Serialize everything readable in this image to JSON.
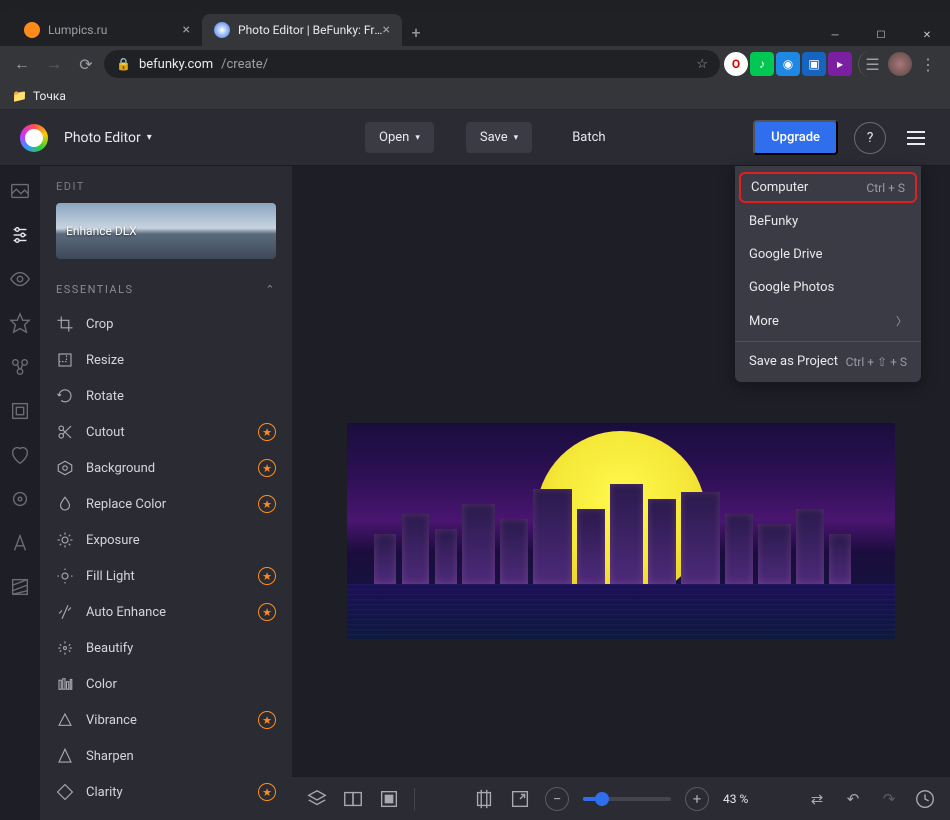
{
  "window": {
    "tabs": [
      {
        "title": "Lumpics.ru",
        "favicon": "#ff8c1a",
        "active": false
      },
      {
        "title": "Photo Editor | BeFunky: Free Onli",
        "favicon": "#2f6fed",
        "active": true
      }
    ]
  },
  "browser": {
    "url_host": "befunky.com",
    "url_path": "/create/",
    "bookmarks": [
      "Точка"
    ]
  },
  "header": {
    "mode": "Photo Editor",
    "open": "Open",
    "save": "Save",
    "batch": "Batch",
    "upgrade": "Upgrade"
  },
  "save_menu": {
    "items": [
      {
        "label": "Computer",
        "shortcut": "Ctrl + S",
        "highlighted": true
      },
      {
        "label": "BeFunky"
      },
      {
        "label": "Google Drive"
      },
      {
        "label": "Google Photos"
      },
      {
        "label": "More",
        "submenu": true
      }
    ],
    "project": {
      "label": "Save as Project",
      "shortcut": "Ctrl + ⇧ + S"
    }
  },
  "sidebar": {
    "title": "EDIT",
    "thumb_label": "Enhance DLX",
    "section": "ESSENTIALS",
    "items": [
      {
        "icon": "crop",
        "label": "Crop",
        "pro": false
      },
      {
        "icon": "resize",
        "label": "Resize",
        "pro": false
      },
      {
        "icon": "rotate",
        "label": "Rotate",
        "pro": false
      },
      {
        "icon": "cutout",
        "label": "Cutout",
        "pro": true
      },
      {
        "icon": "background",
        "label": "Background",
        "pro": true
      },
      {
        "icon": "replace-color",
        "label": "Replace Color",
        "pro": true
      },
      {
        "icon": "exposure",
        "label": "Exposure",
        "pro": false
      },
      {
        "icon": "fill-light",
        "label": "Fill Light",
        "pro": true
      },
      {
        "icon": "auto-enhance",
        "label": "Auto Enhance",
        "pro": true
      },
      {
        "icon": "beautify",
        "label": "Beautify",
        "pro": false
      },
      {
        "icon": "color",
        "label": "Color",
        "pro": false
      },
      {
        "icon": "vibrance",
        "label": "Vibrance",
        "pro": true
      },
      {
        "icon": "sharpen",
        "label": "Sharpen",
        "pro": false
      },
      {
        "icon": "clarity",
        "label": "Clarity",
        "pro": true
      }
    ]
  },
  "rail": {
    "items": [
      "image",
      "sliders",
      "eye",
      "star",
      "graph",
      "square",
      "heart",
      "gear",
      "text",
      "pattern"
    ]
  },
  "bottom": {
    "zoom_percent": "43 %"
  }
}
